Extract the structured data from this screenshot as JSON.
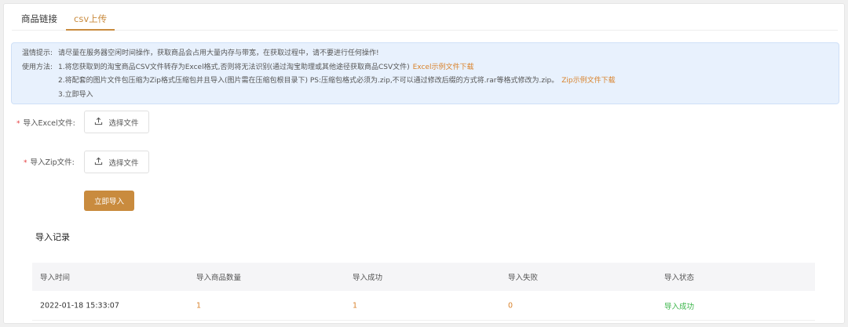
{
  "tabs": [
    {
      "label": "商品链接",
      "active": false
    },
    {
      "label": "csv上传",
      "active": true
    }
  ],
  "notice": {
    "tip_label": "温情提示:",
    "tip_text": "请尽量在服务器空闲时间操作，获取商品会占用大量内存与带宽，在获取过程中，请不要进行任何操作!",
    "usage_label": "使用方法:",
    "step1": "1.将您获取到的淘宝商品CSV文件转存为Excel格式,否则将无法识别(通过淘宝助理或其他途径获取商品CSV文件)",
    "step1_link": "Excel示例文件下载",
    "step2": "2.将配套的图片文件包压缩为Zip格式压缩包并且导入(图片需在压缩包根目录下) PS:压缩包格式必须为.zip,不可以通过修改后缀的方式将.rar等格式修改为.zip。",
    "step2_link": "Zip示例文件下载",
    "step3": "3.立即导入"
  },
  "form": {
    "required_mark": "*",
    "excel_label": "导入Excel文件:",
    "zip_label": "导入Zip文件:",
    "choose_file": "选择文件",
    "submit": "立即导入"
  },
  "records": {
    "title": "导入记录",
    "columns": [
      "导入时间",
      "导入商品数量",
      "导入成功",
      "导入失败",
      "导入状态"
    ],
    "rows": [
      {
        "time": "2022-01-18 15:33:07",
        "count": "1",
        "success": "1",
        "failed": "0",
        "status": "导入成功"
      }
    ]
  },
  "colors": {
    "accent": "#c98b3e",
    "link": "#d9822b",
    "success": "#3bb54a",
    "notice_bg": "#e8f1fd"
  }
}
